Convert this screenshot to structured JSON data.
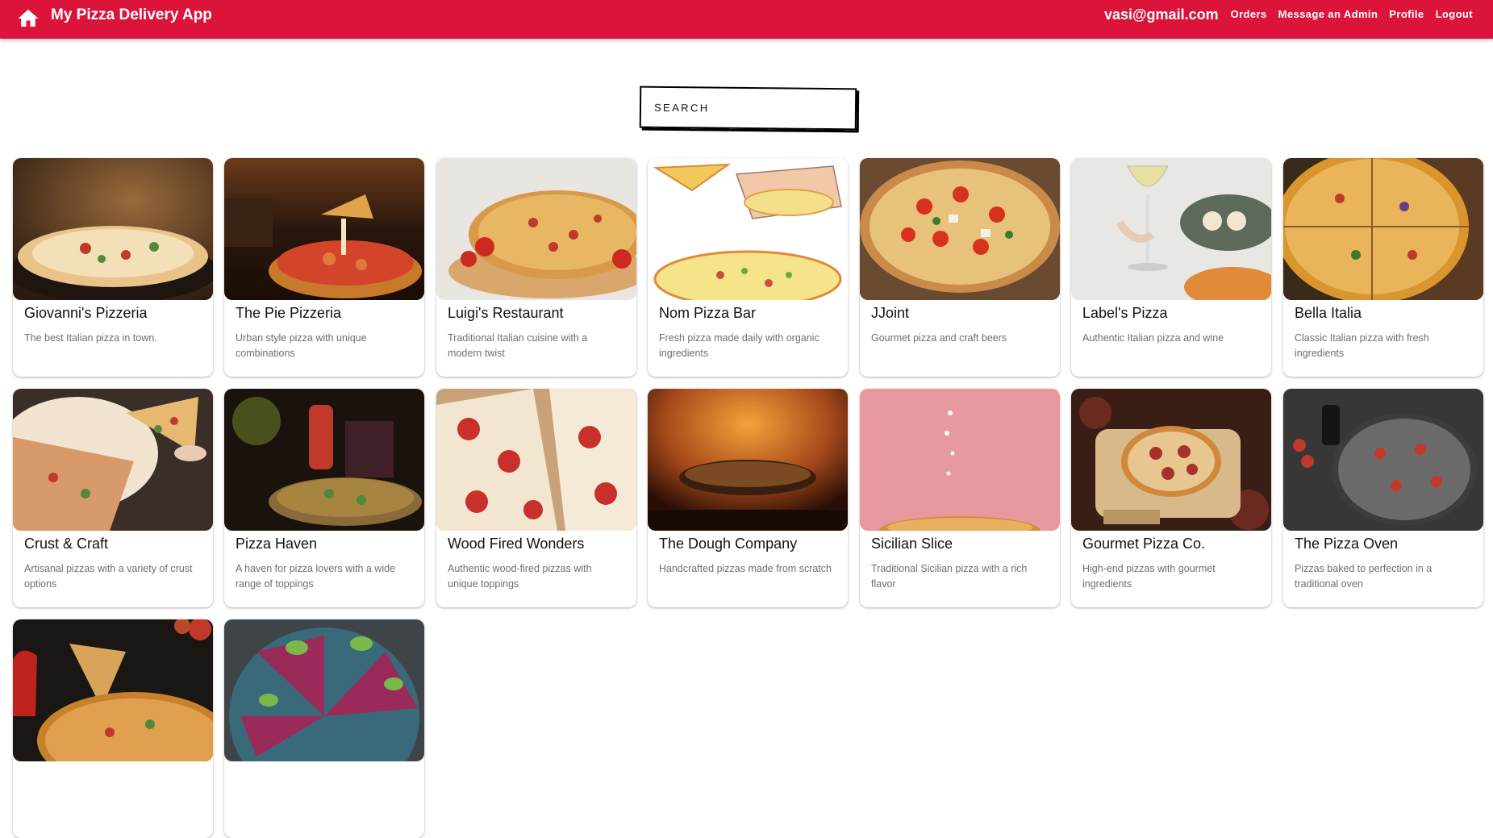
{
  "appbar": {
    "title": "My Pizza Delivery App",
    "email": "vasi@gmail.com",
    "links": [
      "Orders",
      "Message an Admin",
      "Profile",
      "Logout"
    ]
  },
  "search": {
    "placeholder": "SEARCH"
  },
  "restaurants": [
    {
      "name": "Giovanni's Pizzeria",
      "description": "The best Italian pizza in town."
    },
    {
      "name": "The Pie Pizzeria",
      "description": "Urban style pizza with unique combinations"
    },
    {
      "name": "Luigi's Restaurant",
      "description": "Traditional Italian cuisine with a modern twist"
    },
    {
      "name": "Nom Pizza Bar",
      "description": "Fresh pizza made daily with organic ingredients"
    },
    {
      "name": "JJoint",
      "description": "Gourmet pizza and craft beers"
    },
    {
      "name": "Label's Pizza",
      "description": "Authentic Italian pizza and wine"
    },
    {
      "name": "Bella Italia",
      "description": "Classic Italian pizza with fresh ingredients"
    },
    {
      "name": "Crust & Craft",
      "description": "Artisanal pizzas with a variety of crust options"
    },
    {
      "name": "Pizza Haven",
      "description": "A haven for pizza lovers with a wide range of toppings"
    },
    {
      "name": "Wood Fired Wonders",
      "description": "Authentic wood-fired pizzas with unique toppings"
    },
    {
      "name": "The Dough Company",
      "description": "Handcrafted pizzas made from scratch"
    },
    {
      "name": "Sicilian Slice",
      "description": "Traditional Sicilian pizza with a rich flavor"
    },
    {
      "name": "Gourmet Pizza Co.",
      "description": "High-end pizzas with gourmet ingredients"
    },
    {
      "name": "The Pizza Oven",
      "description": "Pizzas baked to perfection in a traditional oven"
    },
    {
      "name": "",
      "description": ""
    },
    {
      "name": "",
      "description": ""
    }
  ],
  "colors": {
    "appbar": "#dc143c",
    "text_muted": "#6e6e6e"
  },
  "icons": {
    "home": "home-icon"
  }
}
